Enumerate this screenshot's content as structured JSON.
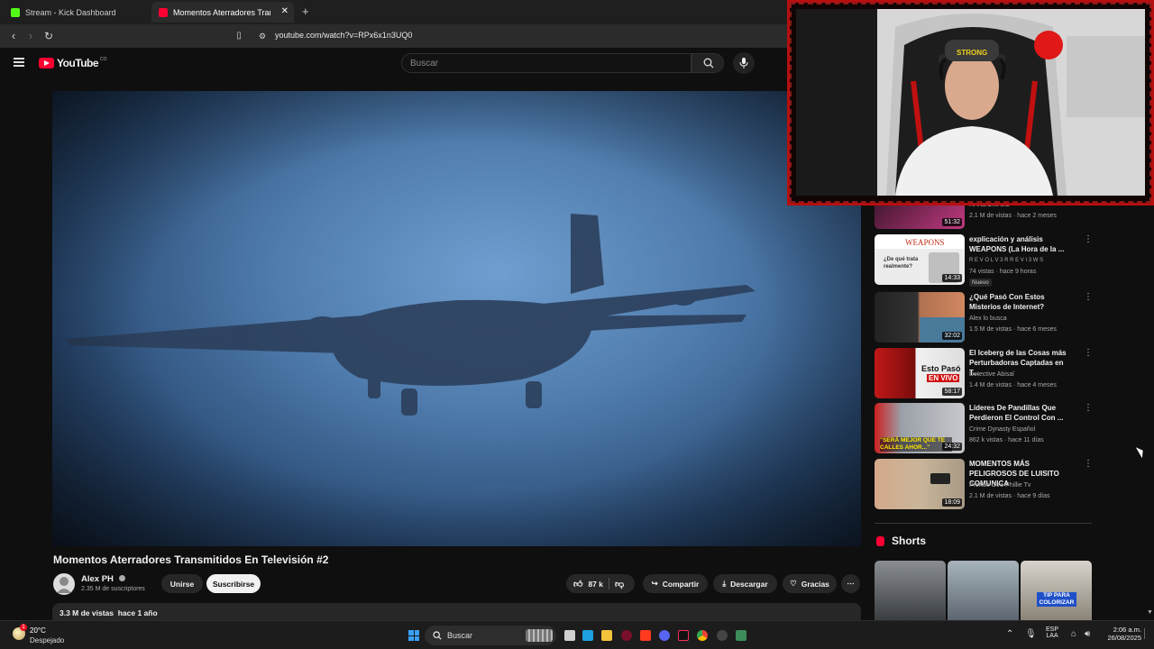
{
  "browser": {
    "tabs": [
      {
        "title": "Stream - Kick Dashboard",
        "active": false,
        "color": "#53fc18"
      },
      {
        "title": "Momentos Aterradores Trans",
        "active": true,
        "color": "#ff0033"
      }
    ],
    "url": "youtube.com/watch?v=RPx6x1n3UQ0"
  },
  "youtube": {
    "logo_text": "YouTube",
    "logo_suffix": "CO",
    "search_placeholder": "Buscar"
  },
  "video": {
    "title": "Momentos Aterradores Transmitidos En Televisión #2",
    "channel": "Alex PH",
    "subscribers": "2.35 M de suscriptores",
    "join_label": "Unirse",
    "subscribe_label": "Suscribirse",
    "likes": "87 k",
    "share_label": "Compartir",
    "download_label": "Descargar",
    "thanks_label": "Gracias",
    "views_info": "3.3 M de vistas  hace 1 año"
  },
  "sidebar": {
    "partial_top": {
      "title": "...",
      "channel": "RANDOMALO",
      "meta": "2.1 M de vistas · hace 2 meses",
      "duration": "51:32",
      "thumb_color": "#b0306a"
    },
    "items": [
      {
        "title": "explicación y análisis WEAPONS (La Hora de la ...",
        "channel": "R E V O L V 3 R R E V I 3 W S",
        "meta": "74 vistas · hace 9 horas",
        "badge": "Nuevo",
        "duration": "14:33",
        "thumb_text": "WEAPONS",
        "thumb_text2": "¿De qué trata realmente?",
        "thumb_color": "#e8e8e8"
      },
      {
        "title": "¿Qué Pasó Con Estos Misterios de Internet?",
        "channel": "Alex lo busca",
        "meta": "1.5 M de vistas · hace 6 meses",
        "badge": "",
        "duration": "32:02",
        "thumb_text": "",
        "thumb_text2": "",
        "thumb_color": "#6a3a24"
      },
      {
        "title": "El Iceberg de las Cosas más Perturbadoras Captadas en T...",
        "channel": "Detective Abisal",
        "meta": "1.4 M de vistas · hace 4 meses",
        "badge": "",
        "duration": "58:17",
        "thumb_text": "Esto Pasó",
        "thumb_text2": "EN VIVO",
        "thumb_color": "#5a0f0f"
      },
      {
        "title": "Líderes De Pandillas Que Perdieron El Control Con ...",
        "channel": "Crime Dynasty Español",
        "meta": "862 k vistas · hace 11 días",
        "badge": "",
        "duration": "24:32",
        "thumb_text": "\"SERÁ MEJOR QUE TE CALLES AHOR...\"",
        "thumb_text2": "",
        "thumb_color": "#8a8e96"
      },
      {
        "title": "MOMENTOS MÁS PELIGROSOS DE LUISITO COMUNICA",
        "channel": "Prende Otro Phillie Tv",
        "meta": "2.1 M de vistas · hace 9 días",
        "badge": "",
        "duration": "18:09",
        "thumb_text": "",
        "thumb_text2": "",
        "thumb_color": "#c9b59a"
      }
    ],
    "shorts_label": "Shorts",
    "shorts_thumb_text": "TIP PARA COLORIZAR"
  },
  "taskbar": {
    "temperature": "20°C",
    "weather": "Despejado",
    "search_label": "Buscar",
    "lang": "ESP",
    "lang2": "LAA",
    "time": "2:06 a.m.",
    "date": "26/08/2025",
    "notification_count": "1"
  },
  "colors": {
    "yt_red": "#ff0033",
    "cam_border": "#b50f0f",
    "kick_green": "#53fc18"
  }
}
